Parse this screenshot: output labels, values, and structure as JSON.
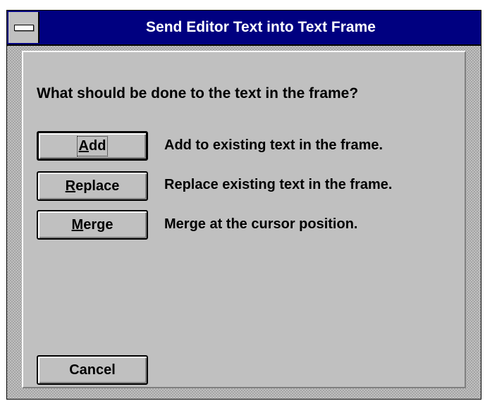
{
  "window": {
    "title": "Send Editor Text into Text Frame"
  },
  "dialog": {
    "question": "What should be done to the text in the frame?",
    "options": [
      {
        "pre": "",
        "mnemonic": "A",
        "post": "dd",
        "description": "Add to existing text in the frame."
      },
      {
        "pre": "",
        "mnemonic": "R",
        "post": "eplace",
        "description": "Replace existing text in the frame."
      },
      {
        "pre": "",
        "mnemonic": "M",
        "post": "erge",
        "description": "Merge at the cursor position."
      }
    ],
    "cancel_label": "Cancel"
  },
  "colors": {
    "titlebar": "#000080",
    "face": "#c0c0c0",
    "text": "#000000"
  }
}
